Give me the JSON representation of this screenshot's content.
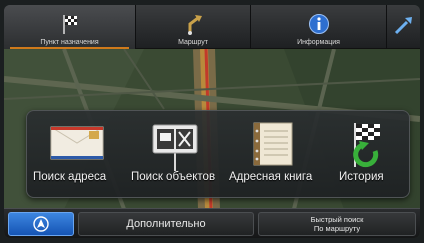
{
  "tabs": [
    {
      "label": "Пункт назначения",
      "icon": "checkered-flag-icon",
      "active": true
    },
    {
      "label": "Маршрут",
      "icon": "route-arrow-icon",
      "active": false
    },
    {
      "label": "Информация",
      "icon": "info-icon",
      "active": false
    },
    {
      "label": "",
      "icon": "settings-tools-icon",
      "active": false
    }
  ],
  "menu": {
    "items": [
      {
        "label": "Поиск адреса",
        "icon": "envelope-icon"
      },
      {
        "label": "Поиск объектов",
        "icon": "poi-signpost-icon"
      },
      {
        "label": "Адресная книга",
        "icon": "address-book-icon"
      },
      {
        "label": "История",
        "icon": "history-flag-icon"
      }
    ]
  },
  "bottom": {
    "more_label": "Дополнительно",
    "quick_line1": "Быстрый поиск",
    "quick_line2": "По маршруту"
  },
  "colors": {
    "accent_orange": "#d07a1b",
    "nav_blue": "#1f64c4",
    "panel_bg": "#24282a"
  }
}
